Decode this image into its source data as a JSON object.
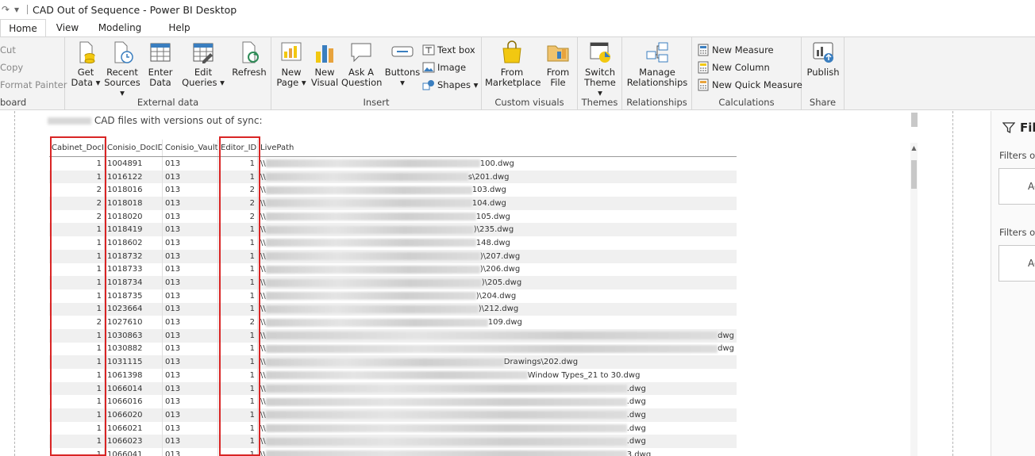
{
  "window": {
    "title": "CAD Out of Sequence - Power BI Desktop"
  },
  "tabs": [
    {
      "label": "Home",
      "active": true
    },
    {
      "label": "View",
      "active": false
    },
    {
      "label": "Modeling",
      "active": false
    },
    {
      "label": "Help",
      "active": false
    }
  ],
  "ribbon": {
    "clipboard": {
      "items": [
        "Cut",
        "Copy",
        "Format Painter"
      ],
      "label": "board"
    },
    "external_data": {
      "label": "External data",
      "get_data": [
        "Get",
        "Data"
      ],
      "recent_sources": [
        "Recent",
        "Sources"
      ],
      "enter_data": [
        "Enter",
        "Data"
      ],
      "edit_queries": [
        "Edit",
        "Queries"
      ],
      "refresh": "Refresh"
    },
    "insert": {
      "label": "Insert",
      "new_page": [
        "New",
        "Page"
      ],
      "new_visual": [
        "New",
        "Visual"
      ],
      "ask_question": [
        "Ask A",
        "Question"
      ],
      "buttons": "Buttons",
      "text_box": "Text box",
      "image": "Image",
      "shapes": "Shapes"
    },
    "custom_visuals": {
      "label": "Custom visuals",
      "from_marketplace": [
        "From",
        "Marketplace"
      ],
      "from_file": [
        "From",
        "File"
      ]
    },
    "themes": {
      "label": "Themes",
      "switch_theme": [
        "Switch",
        "Theme"
      ]
    },
    "relationships": {
      "label": "Relationships",
      "manage": [
        "Manage",
        "Relationships"
      ]
    },
    "calculations": {
      "label": "Calculations",
      "new_measure": "New Measure",
      "new_column": "New Column",
      "new_quick_measure": "New Quick Measure"
    },
    "share": {
      "label": "Share",
      "publish": "Publish"
    }
  },
  "report": {
    "subtitle": "CAD files with versions out of sync:",
    "columns": [
      "Cabinet_DocID",
      "Conisio_DocID",
      "Conisio_Vault",
      "Editor_ID",
      "LivePath"
    ],
    "rows": [
      {
        "cab": "1",
        "doc": "1004891",
        "vault": "013",
        "editor": "1",
        "path": "\\\\",
        "suffix": "100.dwg"
      },
      {
        "cab": "1",
        "doc": "1016122",
        "vault": "013",
        "editor": "1",
        "path": "\\\\",
        "suffix": "s\\201.dwg"
      },
      {
        "cab": "2",
        "doc": "1018016",
        "vault": "013",
        "editor": "2",
        "path": "\\\\",
        "suffix": "103.dwg"
      },
      {
        "cab": "2",
        "doc": "1018018",
        "vault": "013",
        "editor": "2",
        "path": "\\\\",
        "suffix": "104.dwg"
      },
      {
        "cab": "2",
        "doc": "1018020",
        "vault": "013",
        "editor": "2",
        "path": "\\\\",
        "suffix": "105.dwg"
      },
      {
        "cab": "1",
        "doc": "1018419",
        "vault": "013",
        "editor": "1",
        "path": "\\\\",
        "suffix": ")\\235.dwg"
      },
      {
        "cab": "1",
        "doc": "1018602",
        "vault": "013",
        "editor": "1",
        "path": "\\\\",
        "suffix": "148.dwg"
      },
      {
        "cab": "1",
        "doc": "1018732",
        "vault": "013",
        "editor": "1",
        "path": "\\\\",
        "suffix": ")\\207.dwg"
      },
      {
        "cab": "1",
        "doc": "1018733",
        "vault": "013",
        "editor": "1",
        "path": "\\\\",
        "suffix": ")\\206.dwg"
      },
      {
        "cab": "1",
        "doc": "1018734",
        "vault": "013",
        "editor": "1",
        "path": "\\\\",
        "suffix": ")\\205.dwg"
      },
      {
        "cab": "1",
        "doc": "1018735",
        "vault": "013",
        "editor": "1",
        "path": "\\\\",
        "suffix": ")\\204.dwg"
      },
      {
        "cab": "1",
        "doc": "1023664",
        "vault": "013",
        "editor": "1",
        "path": "\\\\",
        "suffix": ")\\212.dwg"
      },
      {
        "cab": "2",
        "doc": "1027610",
        "vault": "013",
        "editor": "2",
        "path": "\\\\",
        "suffix": "109.dwg"
      },
      {
        "cab": "1",
        "doc": "1030863",
        "vault": "013",
        "editor": "1",
        "path": "\\\\",
        "suffix": "dwg"
      },
      {
        "cab": "1",
        "doc": "1030882",
        "vault": "013",
        "editor": "1",
        "path": "\\\\",
        "suffix": "dwg"
      },
      {
        "cab": "1",
        "doc": "1031115",
        "vault": "013",
        "editor": "1",
        "path": "\\\\",
        "suffix": "Drawings\\202.dwg"
      },
      {
        "cab": "1",
        "doc": "1061398",
        "vault": "013",
        "editor": "1",
        "path": "\\\\",
        "suffix": "Window Types_21 to 30.dwg"
      },
      {
        "cab": "1",
        "doc": "1066014",
        "vault": "013",
        "editor": "1",
        "path": "\\\\",
        "suffix": ".dwg"
      },
      {
        "cab": "1",
        "doc": "1066016",
        "vault": "013",
        "editor": "1",
        "path": "\\\\",
        "suffix": ".dwg"
      },
      {
        "cab": "1",
        "doc": "1066020",
        "vault": "013",
        "editor": "1",
        "path": "\\\\",
        "suffix": ".dwg"
      },
      {
        "cab": "1",
        "doc": "1066021",
        "vault": "013",
        "editor": "1",
        "path": "\\\\",
        "suffix": ".dwg"
      },
      {
        "cab": "1",
        "doc": "1066023",
        "vault": "013",
        "editor": "1",
        "path": "\\\\",
        "suffix": ".dwg"
      },
      {
        "cab": "1",
        "doc": "1066041",
        "vault": "013",
        "editor": "1",
        "path": "\\\\",
        "suffix": "3.dwg"
      }
    ]
  },
  "filters": {
    "header": "Filt",
    "label1": "Filters or",
    "button1": "Ac",
    "label2": "Filters or",
    "button2": "Ac"
  },
  "colors": {
    "highlight": "#d92525",
    "ribbon_bg": "#f3f3f3",
    "accent": "#f2c811"
  }
}
